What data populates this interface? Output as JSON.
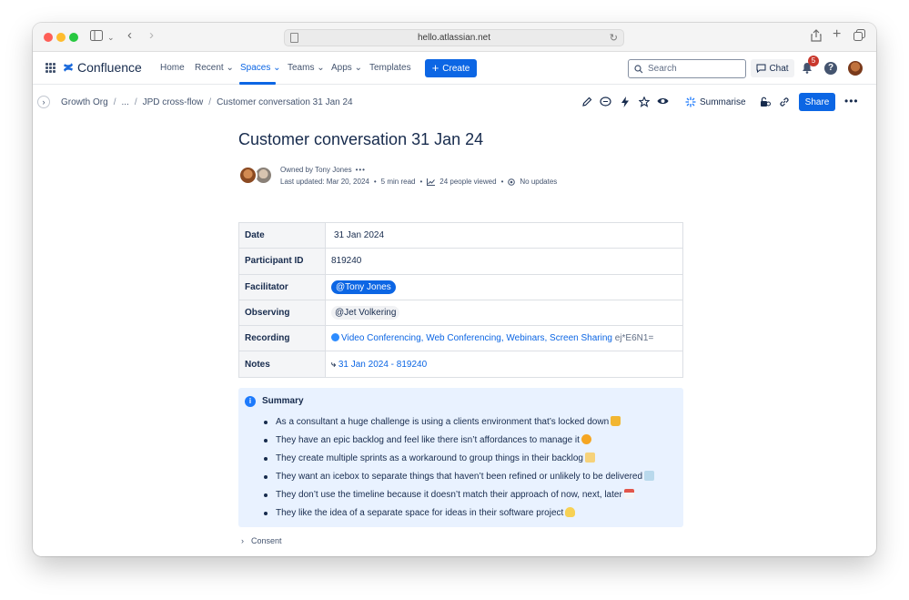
{
  "browser": {
    "url": "hello.atlassian.net"
  },
  "nav": {
    "product": "Confluence",
    "items": [
      {
        "label": "Home"
      },
      {
        "label": "Recent ⌄"
      },
      {
        "label": "Spaces ⌄"
      },
      {
        "label": "Teams ⌄"
      },
      {
        "label": "Apps ⌄"
      },
      {
        "label": "Templates"
      }
    ],
    "create_label": "Create",
    "search_placeholder": "Search",
    "chat_label": "Chat",
    "notification_count": "5",
    "help_label": "?"
  },
  "breadcrumb": {
    "items": [
      "Growth Org",
      "...",
      "JPD cross-flow",
      "Customer conversation 31 Jan 24"
    ]
  },
  "toolbar": {
    "summarise_label": "Summarise",
    "share_label": "Share"
  },
  "page": {
    "title": "Customer conversation 31 Jan 24",
    "owner": "Owned by Tony Jones",
    "last_updated": "Last updated: Mar 20, 2024",
    "read_time": "5 min read",
    "views": "24 people viewed",
    "updates": "No updates"
  },
  "table": {
    "rows": [
      {
        "key": "Date",
        "value": "31 Jan 2024"
      },
      {
        "key": "Participant ID",
        "value": "819240"
      },
      {
        "key": "Facilitator",
        "value": "@Tony Jones"
      },
      {
        "key": "Observing",
        "value": "@Jet Volkering"
      },
      {
        "key": "Recording",
        "value": "Video Conferencing, Web Conferencing, Webinars, Screen Sharing",
        "extra": "ej*E6N1="
      },
      {
        "key": "Notes",
        "value": "31 Jan 2024 - 819240"
      }
    ]
  },
  "summary": {
    "title": "Summary",
    "items": [
      {
        "text": "As a consultant a huge challenge is using a clients environment that’s locked down",
        "emoji": "lock-emoji",
        "color": "#f2b632"
      },
      {
        "text": "They have an epic backlog and feel like there isn’t affordances to manage it",
        "emoji": "steam-face-emoji",
        "color": "#f5a623"
      },
      {
        "text": "They create multiple sprints as a workaround to group things in their backlog",
        "emoji": "folder-emoji",
        "color": "#f6d27a"
      },
      {
        "text": "They want an icebox to separate things that haven’t been refined or unlikely to be delivered",
        "emoji": "ice-emoji",
        "color": "#b9d9ec"
      },
      {
        "text": "They don’t use the timeline because it doesn’t match their approach of now, next, later",
        "emoji": "calendar-emoji",
        "color": "#e2564b"
      },
      {
        "text": "They like the idea of a separate space for ideas in their software project",
        "emoji": "bulb-emoji",
        "color": "#f7d154"
      }
    ]
  },
  "consent": {
    "label": "Consent"
  },
  "colors": {
    "accent": "#0c66e4",
    "panel_bg": "#e9f2ff"
  }
}
